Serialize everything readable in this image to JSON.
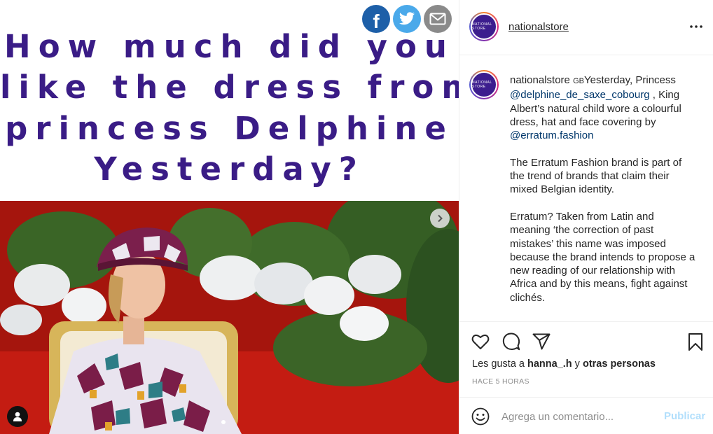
{
  "post": {
    "question_lines": [
      "How much did you",
      "like the dress from",
      "princess Delphine",
      "Yesterday?"
    ],
    "share_icons": [
      "facebook-icon",
      "twitter-icon",
      "mail-icon"
    ]
  },
  "header": {
    "username": "nationalstore",
    "avatar_text": "NATIONAL STORE"
  },
  "caption": {
    "username": "nationalstore",
    "flag": "GB",
    "paragraph1_start": "Yesterday, Princess ",
    "mention1": "@delphine_de_saxe_cobourg",
    "paragraph1_mid": " , King Albert’s natural child wore a colourful dress, hat and face covering by ",
    "mention2": "@erratum.fashion",
    "paragraph2": "The Erratum Fashion brand is part of the trend of brands that claim their mixed Belgian identity.",
    "paragraph3": "Erratum? Taken from Latin and meaning ‘the correction of past mistakes’ this name was imposed because the brand intends to propose a new reading of our relationship with Africa and by this means, fight against clichés."
  },
  "actions": {
    "likes_prefix": "Les gusta a ",
    "likes_user": "hanna_.h",
    "likes_conj": " y ",
    "likes_others": "otras personas",
    "time": "HACE 5 HORAS"
  },
  "comment": {
    "placeholder": "Agrega un comentario...",
    "publish_label": "Publicar"
  },
  "colors": {
    "headline": "#3a1c86",
    "facebook": "#1d5fa8",
    "twitter": "#4aa9ea",
    "mail": "#8a8a8a",
    "mention": "#00376b",
    "publish": "#b2dffc"
  }
}
